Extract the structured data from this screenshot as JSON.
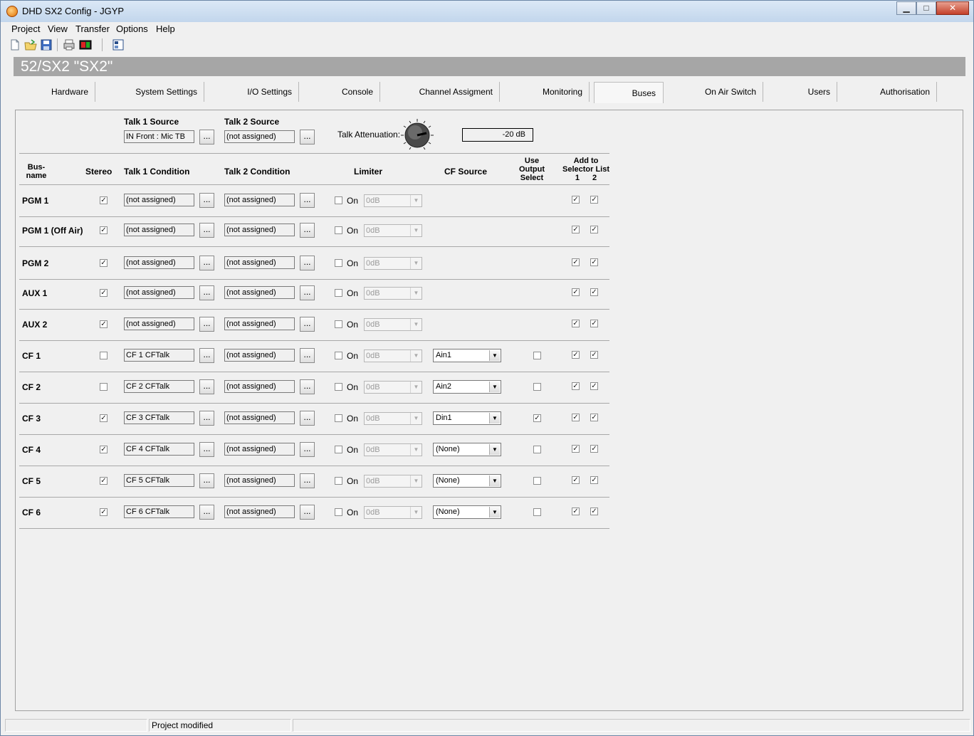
{
  "window": {
    "title": "DHD SX2 Config - JGYP",
    "minimize": "▁",
    "maximize": "□",
    "close": "✕"
  },
  "menu": [
    "Project",
    "View",
    "Transfer",
    "Options",
    "Help"
  ],
  "header": {
    "title": "52/SX2 \"SX2\""
  },
  "tabs": [
    "Hardware",
    "System Settings",
    "I/O Settings",
    "Console",
    "Channel Assigment",
    "Monitoring",
    "Buses",
    "On Air Switch",
    "Users",
    "Authorisation"
  ],
  "active_tab": "Buses",
  "talk": {
    "source1_label": "Talk 1 Source",
    "source1_value": "IN Front : Mic TB",
    "source2_label": "Talk 2 Source",
    "source2_value": "(not assigned)",
    "attenuation_label": "Talk Attenuation:",
    "attenuation_value": "-20 dB",
    "dots": "..."
  },
  "columns": {
    "busname1": "Bus-",
    "busname2": "name",
    "stereo": "Stereo",
    "talk1": "Talk 1 Condition",
    "talk2": "Talk 2 Condition",
    "limiter": "Limiter",
    "cfsource": "CF Source",
    "use1": "Use",
    "use2": "Output",
    "use3": "Select",
    "add1": "Add to",
    "add2": "Selector List",
    "sel1": "1",
    "sel2": "2"
  },
  "limiter_on_label": "On",
  "check_mark": "✓",
  "rows": [
    {
      "name": "PGM 1",
      "stereo": true,
      "talk1": "(not assigned)",
      "talk2": "(not assigned)",
      "limiter_on": false,
      "limiter_value": "0dB",
      "cf_source": null,
      "use_output": null,
      "sel1": true,
      "sel2": true
    },
    {
      "name": "PGM 1 (Off Air)",
      "stereo": true,
      "talk1": "(not assigned)",
      "talk2": "(not assigned)",
      "limiter_on": false,
      "limiter_value": "0dB",
      "cf_source": null,
      "use_output": null,
      "sel1": true,
      "sel2": true
    },
    {
      "name": "PGM 2",
      "stereo": true,
      "talk1": "(not assigned)",
      "talk2": "(not assigned)",
      "limiter_on": false,
      "limiter_value": "0dB",
      "cf_source": null,
      "use_output": null,
      "sel1": true,
      "sel2": true
    },
    {
      "name": "AUX 1",
      "stereo": true,
      "talk1": "(not assigned)",
      "talk2": "(not assigned)",
      "limiter_on": false,
      "limiter_value": "0dB",
      "cf_source": null,
      "use_output": null,
      "sel1": true,
      "sel2": true
    },
    {
      "name": "AUX 2",
      "stereo": true,
      "talk1": "(not assigned)",
      "talk2": "(not assigned)",
      "limiter_on": false,
      "limiter_value": "0dB",
      "cf_source": null,
      "use_output": null,
      "sel1": true,
      "sel2": true
    },
    {
      "name": "CF 1",
      "stereo": false,
      "talk1": "CF 1 CFTalk",
      "talk2": "(not assigned)",
      "limiter_on": false,
      "limiter_value": "0dB",
      "cf_source": "Ain1",
      "use_output": false,
      "sel1": true,
      "sel2": true
    },
    {
      "name": "CF 2",
      "stereo": false,
      "talk1": "CF 2 CFTalk",
      "talk2": "(not assigned)",
      "limiter_on": false,
      "limiter_value": "0dB",
      "cf_source": "Ain2",
      "use_output": false,
      "sel1": true,
      "sel2": true
    },
    {
      "name": "CF 3",
      "stereo": true,
      "talk1": "CF 3 CFTalk",
      "talk2": "(not assigned)",
      "limiter_on": false,
      "limiter_value": "0dB",
      "cf_source": "Din1",
      "use_output": true,
      "sel1": true,
      "sel2": true
    },
    {
      "name": "CF 4",
      "stereo": true,
      "talk1": "CF 4 CFTalk",
      "talk2": "(not assigned)",
      "limiter_on": false,
      "limiter_value": "0dB",
      "cf_source": "(None)",
      "use_output": false,
      "sel1": true,
      "sel2": true
    },
    {
      "name": "CF 5",
      "stereo": true,
      "talk1": "CF 5 CFTalk",
      "talk2": "(not assigned)",
      "limiter_on": false,
      "limiter_value": "0dB",
      "cf_source": "(None)",
      "use_output": false,
      "sel1": true,
      "sel2": true
    },
    {
      "name": "CF 6",
      "stereo": true,
      "talk1": "CF 6 CFTalk",
      "talk2": "(not assigned)",
      "limiter_on": false,
      "limiter_value": "0dB",
      "cf_source": "(None)",
      "use_output": false,
      "sel1": true,
      "sel2": true
    }
  ],
  "status": {
    "text": "Project modified"
  }
}
